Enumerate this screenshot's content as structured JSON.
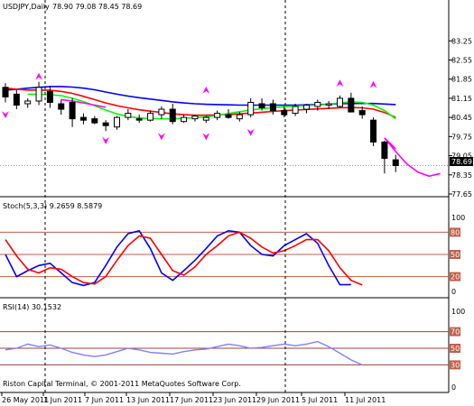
{
  "header": {
    "symbol_label": "USDJPY,Daily",
    "ohlc_label": "78.90 79.08 78.45 78.69"
  },
  "footer": {
    "copyright": "Riston Capital Terminal, © 2001-2011 MetaQuotes Software Corp."
  },
  "colors": {
    "background": "#ffffff",
    "axis": "#000000",
    "grid_separator": "#000000",
    "ma_blue": "#0000ff",
    "ma_red": "#ff0000",
    "ma_green": "#00ff00",
    "magenta": "#ff00ff",
    "stoch_main": "#0000ff",
    "stoch_signal": "#ff0000",
    "level_line": "#c0604a",
    "rsi_line": "#8080ff",
    "fractal": "#ff00ff",
    "price_marker_bg": "#000000",
    "price_marker_text": "#ffffff"
  },
  "chart_data": [
    {
      "type": "candlestick",
      "panel": "price",
      "title": "USDJPY,Daily",
      "ylim": [
        77.65,
        84.15
      ],
      "y_ticks": [
        "83.25",
        "82.55",
        "81.85",
        "81.15",
        "80.45",
        "79.75",
        "79.05",
        "78.35",
        "77.65"
      ],
      "current_price": "78.69",
      "x_tick_labels": [
        "26 May 2011",
        "1 Jun 2011",
        "7 Jun 2011",
        "13 Jun 2011",
        "17 Jun 2011",
        "23 Jun 2011",
        "29 Jun 2011",
        "5 Jul 2011",
        "11 Jul 2011"
      ],
      "x_tick_index": [
        0,
        4,
        8,
        12,
        16,
        20,
        24,
        28,
        32
      ],
      "candles": [
        {
          "o": 81.55,
          "h": 81.7,
          "l": 81.0,
          "c": 81.2
        },
        {
          "o": 81.3,
          "h": 81.45,
          "l": 80.75,
          "c": 80.9
        },
        {
          "o": 80.95,
          "h": 81.15,
          "l": 80.8,
          "c": 81.05
        },
        {
          "o": 81.05,
          "h": 81.75,
          "l": 80.9,
          "c": 81.55
        },
        {
          "o": 81.4,
          "h": 81.6,
          "l": 80.8,
          "c": 81.0
        },
        {
          "o": 80.95,
          "h": 81.1,
          "l": 80.55,
          "c": 80.75
        },
        {
          "o": 81.0,
          "h": 81.15,
          "l": 80.1,
          "c": 80.4
        },
        {
          "o": 80.45,
          "h": 80.6,
          "l": 80.2,
          "c": 80.35
        },
        {
          "o": 80.4,
          "h": 80.5,
          "l": 80.2,
          "c": 80.25
        },
        {
          "o": 80.25,
          "h": 80.35,
          "l": 79.95,
          "c": 80.15
        },
        {
          "o": 80.1,
          "h": 80.5,
          "l": 80.0,
          "c": 80.45
        },
        {
          "o": 80.45,
          "h": 80.75,
          "l": 80.35,
          "c": 80.6
        },
        {
          "o": 80.4,
          "h": 80.55,
          "l": 80.25,
          "c": 80.35
        },
        {
          "o": 80.35,
          "h": 80.7,
          "l": 80.3,
          "c": 80.6
        },
        {
          "o": 80.55,
          "h": 80.85,
          "l": 80.4,
          "c": 80.75
        },
        {
          "o": 80.75,
          "h": 80.95,
          "l": 80.2,
          "c": 80.3
        },
        {
          "o": 80.3,
          "h": 80.55,
          "l": 80.25,
          "c": 80.45
        },
        {
          "o": 80.4,
          "h": 80.55,
          "l": 80.3,
          "c": 80.5
        },
        {
          "o": 80.35,
          "h": 80.5,
          "l": 80.25,
          "c": 80.45
        },
        {
          "o": 80.45,
          "h": 80.7,
          "l": 80.35,
          "c": 80.6
        },
        {
          "o": 80.55,
          "h": 80.75,
          "l": 80.4,
          "c": 80.45
        },
        {
          "o": 80.4,
          "h": 80.65,
          "l": 80.3,
          "c": 80.55
        },
        {
          "o": 80.55,
          "h": 81.15,
          "l": 80.45,
          "c": 81.0
        },
        {
          "o": 80.95,
          "h": 81.15,
          "l": 80.7,
          "c": 80.8
        },
        {
          "o": 80.95,
          "h": 81.1,
          "l": 80.55,
          "c": 80.7
        },
        {
          "o": 80.7,
          "h": 80.85,
          "l": 80.45,
          "c": 80.55
        },
        {
          "o": 80.6,
          "h": 80.95,
          "l": 80.5,
          "c": 80.85
        },
        {
          "o": 80.75,
          "h": 80.95,
          "l": 80.6,
          "c": 80.9
        },
        {
          "o": 80.85,
          "h": 81.1,
          "l": 80.7,
          "c": 81.0
        },
        {
          "o": 80.9,
          "h": 81.05,
          "l": 80.75,
          "c": 80.95
        },
        {
          "o": 80.85,
          "h": 81.25,
          "l": 80.8,
          "c": 81.15
        },
        {
          "o": 81.15,
          "h": 81.35,
          "l": 80.8,
          "c": 80.65
        },
        {
          "o": 80.7,
          "h": 80.85,
          "l": 80.4,
          "c": 80.55
        },
        {
          "o": 80.35,
          "h": 80.45,
          "l": 79.4,
          "c": 79.55
        },
        {
          "o": 79.55,
          "h": 79.6,
          "l": 78.4,
          "c": 78.95
        },
        {
          "o": 78.9,
          "h": 79.08,
          "l": 78.45,
          "c": 78.69
        }
      ],
      "fractals_up": [
        {
          "i": 3,
          "v": 81.95
        },
        {
          "i": 18,
          "v": 81.45
        },
        {
          "i": 30,
          "v": 81.7
        },
        {
          "i": 33,
          "v": 81.65
        }
      ],
      "fractals_down": [
        {
          "i": 0,
          "v": 80.55
        },
        {
          "i": 9,
          "v": 79.6
        },
        {
          "i": 14,
          "v": 79.75
        },
        {
          "i": 18,
          "v": 79.75
        },
        {
          "i": 22,
          "v": 79.9
        }
      ],
      "series": [
        {
          "color_key": "ma_blue",
          "values": [
            81.45,
            81.48,
            81.52,
            81.55,
            81.58,
            81.58,
            81.56,
            81.52,
            81.46,
            81.38,
            81.3,
            81.23,
            81.17,
            81.12,
            81.07,
            81.02,
            80.98,
            80.95,
            80.93,
            80.92,
            80.91,
            80.9,
            80.9,
            80.9,
            80.9,
            80.9,
            80.9,
            80.91,
            80.92,
            80.93,
            80.95,
            80.96,
            80.96,
            80.96,
            80.94,
            80.92
          ]
        },
        {
          "color_key": "ma_red",
          "values": [
            81.52,
            81.48,
            81.45,
            81.45,
            81.44,
            81.4,
            81.33,
            81.22,
            81.1,
            80.98,
            80.88,
            80.8,
            80.73,
            80.68,
            80.63,
            80.58,
            80.55,
            80.53,
            80.53,
            80.54,
            80.56,
            80.58,
            80.61,
            80.64,
            80.67,
            80.7,
            80.72,
            80.74,
            80.76,
            80.78,
            80.8,
            80.81,
            80.8,
            80.75,
            80.63,
            80.45
          ]
        },
        {
          "color_key": "ma_green",
          "values": [
            null,
            null,
            81.3,
            81.3,
            81.28,
            81.25,
            81.15,
            81.03,
            80.88,
            80.72,
            80.58,
            80.48,
            80.43,
            80.41,
            80.4,
            80.4,
            80.42,
            80.44,
            80.47,
            80.52,
            80.59,
            80.66,
            80.72,
            80.77,
            80.81,
            80.84,
            80.86,
            80.88,
            80.9,
            80.93,
            80.98,
            81.02,
            81.0,
            80.9,
            80.7,
            80.4
          ]
        },
        {
          "color_key": "magenta",
          "values": [
            null,
            null,
            null,
            null,
            null,
            81.1,
            81.05,
            80.98,
            80.9,
            80.82,
            null,
            null,
            null,
            null,
            null,
            null,
            null,
            null,
            null,
            null,
            null,
            null,
            null,
            null,
            null,
            null,
            null,
            null,
            null,
            null,
            null,
            null,
            null,
            null,
            79.7,
            79.3
          ]
        }
      ],
      "tail_series": [
        {
          "color_key": "magenta",
          "x": [
            34,
            35,
            36,
            37,
            38,
            39
          ],
          "values": [
            79.7,
            79.2,
            78.75,
            78.45,
            78.3,
            78.4
          ]
        }
      ]
    },
    {
      "type": "line",
      "panel": "stochastic",
      "title": "Stoch(5,3,3) 9.2659 8.5879",
      "ylim": [
        0,
        100
      ],
      "levels": [
        80,
        50,
        20
      ],
      "level_labels": [
        "80",
        "50",
        "20"
      ],
      "y_ticks": [
        "100",
        "0"
      ],
      "series": [
        {
          "name": "main",
          "color_key": "stoch_main",
          "values": [
            50,
            20,
            28,
            35,
            38,
            25,
            12,
            8,
            12,
            35,
            60,
            78,
            82,
            58,
            25,
            15,
            28,
            42,
            58,
            75,
            82,
            80,
            62,
            50,
            48,
            62,
            70,
            78,
            65,
            35,
            9,
            9.3
          ]
        },
        {
          "name": "signal",
          "color_key": "stoch_signal",
          "values": [
            70,
            48,
            30,
            25,
            32,
            30,
            20,
            12,
            10,
            20,
            42,
            62,
            75,
            72,
            50,
            28,
            22,
            33,
            50,
            62,
            75,
            80,
            72,
            60,
            52,
            55,
            62,
            70,
            70,
            55,
            32,
            15,
            8.6
          ]
        }
      ]
    },
    {
      "type": "line",
      "panel": "rsi",
      "title": "RSI(14) 30.1532",
      "ylim": [
        0,
        100
      ],
      "levels": [
        70,
        50,
        30
      ],
      "level_labels": [
        "70",
        "50",
        "30"
      ],
      "y_ticks": [
        "100",
        "0"
      ],
      "series": [
        {
          "name": "RSI",
          "color_key": "rsi_line",
          "values": [
            48,
            50,
            55,
            52,
            54,
            50,
            45,
            42,
            40,
            42,
            46,
            50,
            48,
            45,
            44,
            43,
            46,
            48,
            49,
            52,
            55,
            53,
            50,
            51,
            53,
            55,
            53,
            55,
            58,
            52,
            44,
            36,
            30
          ]
        }
      ]
    }
  ]
}
